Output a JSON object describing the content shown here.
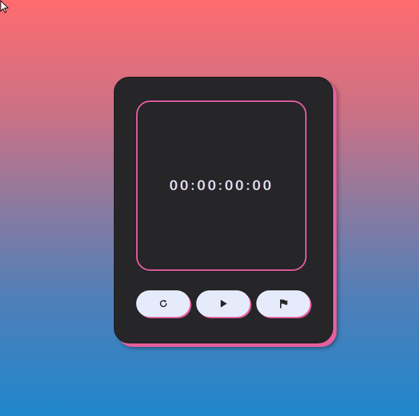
{
  "stopwatch": {
    "time_display": "00:00:00:00"
  },
  "controls": {
    "reset": {
      "icon": "reset-icon"
    },
    "play": {
      "icon": "play-icon"
    },
    "lap": {
      "icon": "flag-icon"
    }
  },
  "colors": {
    "background_top": "#ff6b6f",
    "background_bottom": "#1f86cc",
    "card": "#262528",
    "accent": "#ec5fa8",
    "button": "#e6ebfb",
    "icon": "#262528",
    "text": "#eef3fb"
  }
}
